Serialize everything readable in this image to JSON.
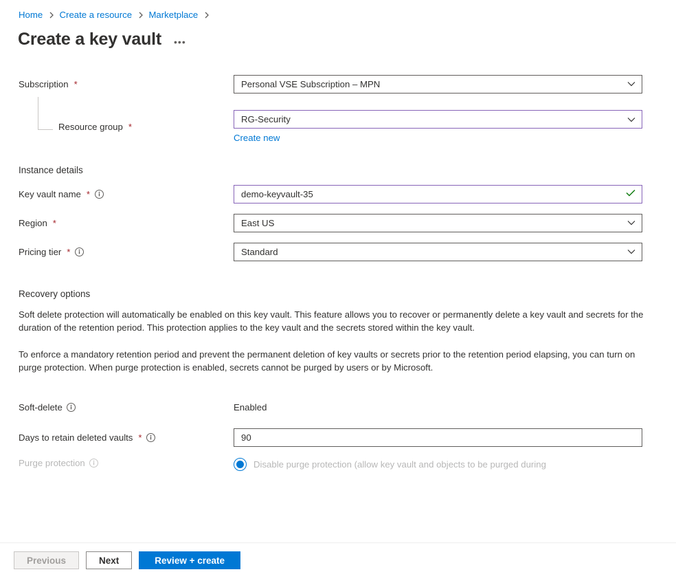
{
  "breadcrumb": {
    "items": [
      "Home",
      "Create a resource",
      "Marketplace"
    ]
  },
  "title": "Create a key vault",
  "form": {
    "subscription": {
      "label": "Subscription",
      "value": "Personal VSE Subscription – MPN"
    },
    "resource_group": {
      "label": "Resource group",
      "value": "RG-Security",
      "create_new": "Create new"
    },
    "instance_section": "Instance details",
    "key_vault_name": {
      "label": "Key vault name",
      "value": "demo-keyvault-35"
    },
    "region": {
      "label": "Region",
      "value": "East US"
    },
    "pricing_tier": {
      "label": "Pricing tier",
      "value": "Standard"
    },
    "recovery_section": "Recovery options",
    "recovery_para1": "Soft delete protection will automatically be enabled on this key vault. This feature allows you to recover or permanently delete a key vault and secrets for the duration of the retention period. This protection applies to the key vault and the secrets stored within the key vault.",
    "recovery_para2": "To enforce a mandatory retention period and prevent the permanent deletion of key vaults or secrets prior to the retention period elapsing, you can turn on purge protection. When purge protection is enabled, secrets cannot be purged by users or by Microsoft.",
    "soft_delete": {
      "label": "Soft-delete",
      "value": "Enabled"
    },
    "retain_days": {
      "label": "Days to retain deleted vaults",
      "value": "90"
    },
    "purge_protection": {
      "label": "Purge protection",
      "option": "Disable purge protection (allow key vault and objects to be purged during"
    }
  },
  "footer": {
    "previous": "Previous",
    "next": "Next",
    "review": "Review + create"
  }
}
